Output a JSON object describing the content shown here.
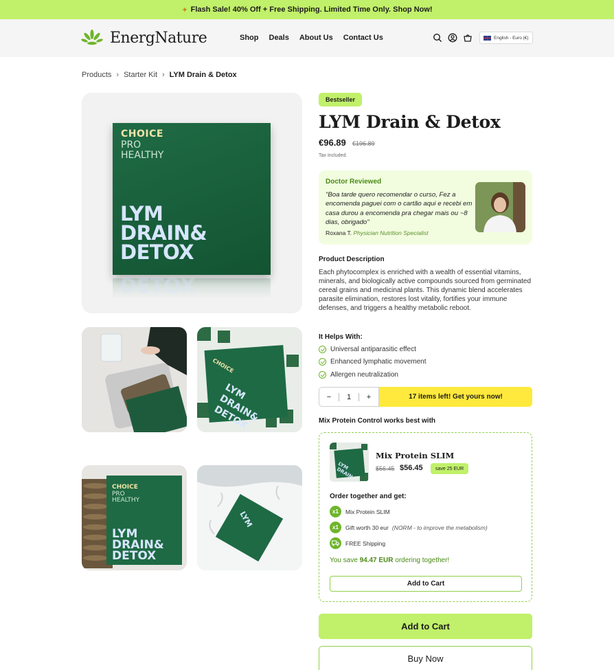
{
  "promo": {
    "icon": "party-popper-icon",
    "text": "Flash Sale! 40% Off + Free Shipping. Limited Time Only. Shop Now!"
  },
  "header": {
    "brand": "EnergNature",
    "nav": [
      "Shop",
      "Deals",
      "About Us",
      "Contact Us"
    ],
    "icons": [
      "search-icon",
      "user-icon",
      "cart-icon"
    ],
    "language": "English - Euro (€)"
  },
  "breadcrumb": {
    "items": [
      "Products",
      "Starter Kit"
    ],
    "current": "LYM Drain & Detox"
  },
  "product": {
    "badge": "Bestseller",
    "title": "LYM Drain & Detox",
    "price": "€96.89",
    "old_price": "€196.89",
    "tax": "Tax Included.",
    "packaging": {
      "brand": "CHOICE",
      "line1": "PRO",
      "line2": "HEALTHY",
      "big1": "LYM",
      "big2": "DRAIN&",
      "big3": "DETOX"
    }
  },
  "review": {
    "heading": "Doctor Reviewed",
    "quote": "\"Boa tarde quero recomendar o curso, Fez a encomenda paguei com o cartão aqui e recebi em casa durou a encomenda pra chegar mais ou ~8 dias, obrigado\"",
    "author": "Roxana T.",
    "role": "Physician Nutrition Specialist"
  },
  "description": {
    "title": "Product Description",
    "text": "Each phytocomplex is enriched with a wealth of essential vitamins, minerals, and biologically active compounds sourced from germinated cereal grains and medicinal plants. This dynamic blend accelerates parasite elimination, restores lost vitality, fortifies your immune defenses, and triggers a healthy metabolic reboot."
  },
  "helps": {
    "title": "It Helps With:",
    "items": [
      "Universal antiparasitic effect",
      "Enhanced lymphatic movement",
      "Allergen neutralization"
    ]
  },
  "quantity": {
    "minus": "−",
    "value": "1",
    "plus": "+",
    "stock_message": "17 items left! Get yours now!"
  },
  "bundle": {
    "heading": "Mix Protein Control works best with",
    "name": "Mix Protein SLIM",
    "old_price": "$56.45",
    "price": "$56.45",
    "save_badge": "save 25 EUR",
    "order_title": "Order together and get:",
    "lines": [
      {
        "icon": "x1",
        "text": "Mix Protein SLIM",
        "note": ""
      },
      {
        "icon": "x1",
        "text": "Gift worth 30 eur",
        "note": "(NORM - to improve the metabolism)"
      },
      {
        "icon": "truck-icon",
        "text": "FREE Shipping",
        "note": ""
      }
    ],
    "savings_prefix": "You save",
    "savings_amount": "94.47 EUR",
    "savings_suffix": "ordering together!",
    "cart_label": "Add to Cart"
  },
  "actions": {
    "add_to_cart": "Add to Cart",
    "buy_now": "Buy Now"
  },
  "colors": {
    "accent": "#c1f06a",
    "accent_dark": "#6fb52c",
    "stock": "#ffe93c",
    "review_bg": "#f2fde0",
    "package": "#1f6b45"
  }
}
